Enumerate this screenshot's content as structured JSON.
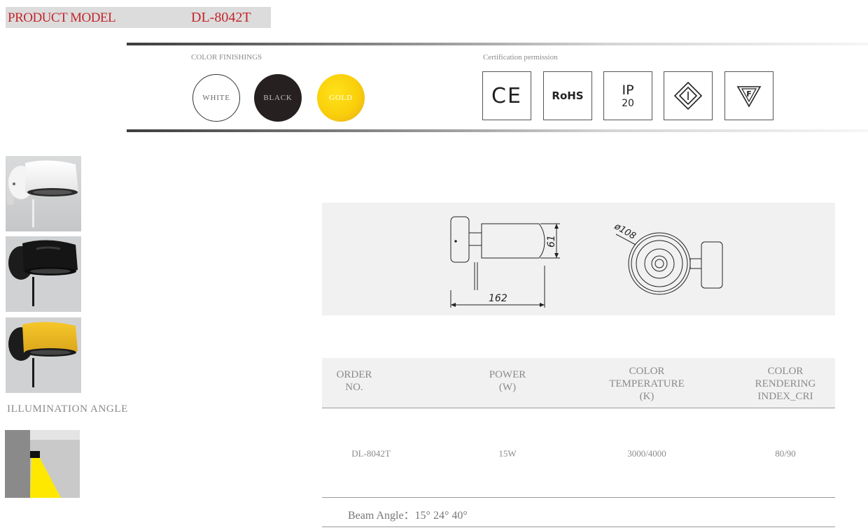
{
  "header": {
    "label": "PRODUCT MODEL",
    "model": "DL-8042T"
  },
  "finishes": {
    "label": "COLOR FINISHINGS",
    "swatches": [
      {
        "name": "WHITE",
        "color": "#ffffff"
      },
      {
        "name": "BLACK",
        "color": "#262120"
      },
      {
        "name": "GOLD",
        "color": "#f9cf0a"
      }
    ]
  },
  "certification": {
    "label": "Certification permission",
    "badges": [
      "CE",
      "RoHS",
      "IP",
      "20",
      "class-ii-icon",
      "f-mark-icon"
    ]
  },
  "illumination": {
    "label": "ILLUMINATION ANGLE"
  },
  "drawing": {
    "dim_height": "61",
    "dim_width": "162",
    "dim_diameter": "ø108"
  },
  "table": {
    "headers": [
      [
        "ORDER",
        "NO."
      ],
      [
        "POWER",
        "(W)"
      ],
      [
        "COLOR",
        "TEMPERATURE",
        "(K)"
      ],
      [
        "COLOR",
        "RENDERING",
        "INDEX_CRI"
      ]
    ],
    "row": [
      "DL-8042T",
      "15W",
      "3000/4000",
      "80/90"
    ]
  },
  "beam": "Beam Angle：15°  24°  40°"
}
